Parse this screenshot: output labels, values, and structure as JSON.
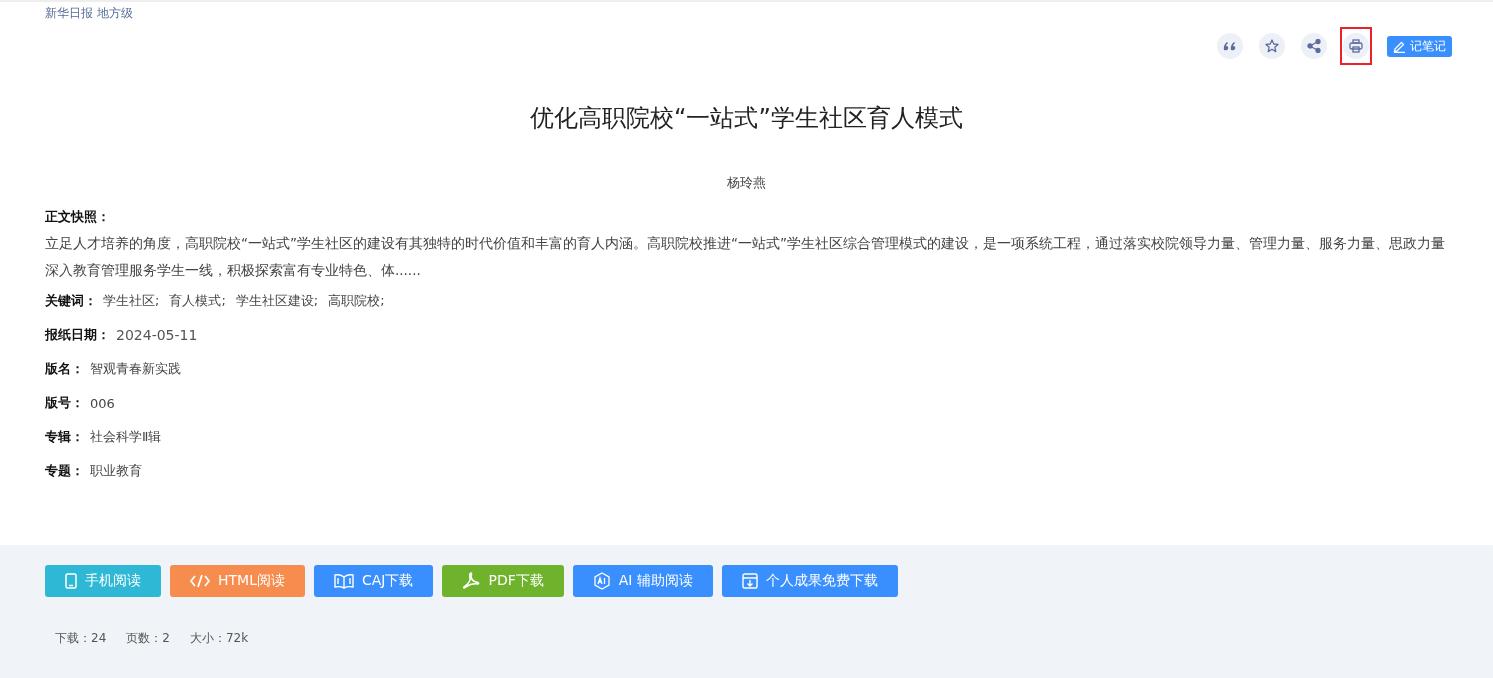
{
  "source": {
    "name": "新华日报",
    "level": "地方级"
  },
  "tools": [
    {
      "kind": "quote",
      "highlighted": false
    },
    {
      "kind": "star",
      "highlighted": false
    },
    {
      "kind": "share",
      "highlighted": false
    },
    {
      "kind": "print",
      "highlighted": true
    }
  ],
  "note_button": {
    "label": "记笔记"
  },
  "title": "优化高职院校“一站式”学生社区育人模式",
  "author": "杨玲燕",
  "snapshot": {
    "label": "正文快照：",
    "text": "立足人才培养的角度，高职院校“一站式”学生社区的建设有其独特的时代价值和丰富的育人内涵。高职院校推进“一站式”学生社区综合管理模式的建设，是一项系统工程，通过落实校院领导力量、管理力量、服务力量、思政力量深入教育管理服务学生一线，积极探索富有专业特色、体......"
  },
  "keywords": {
    "label": "关键词：",
    "items": [
      "学生社区;",
      "育人模式;",
      "学生社区建设;",
      "高职院校;"
    ]
  },
  "fields": [
    {
      "label": "报纸日期：",
      "value": "2024-05-11"
    },
    {
      "label": "版名：",
      "value": "智观青春新实践"
    },
    {
      "label": "版号：",
      "value": "006"
    },
    {
      "label": "专辑：",
      "value": "社会科学Ⅱ辑"
    },
    {
      "label": "专题：",
      "value": "职业教育"
    }
  ],
  "actions": [
    {
      "kind": "phone",
      "label": "手机阅读",
      "color": "#2fb8d6"
    },
    {
      "kind": "code",
      "label": "HTML阅读",
      "color": "#f68c4e"
    },
    {
      "kind": "book",
      "label": "CAJ下载",
      "color": "#3a8ffe"
    },
    {
      "kind": "pdf",
      "label": "PDF下载",
      "color": "#6fb32d"
    },
    {
      "kind": "ai",
      "label": "AI 辅助阅读",
      "color": "#3a8ffe"
    },
    {
      "kind": "download",
      "label": "个人成果免费下载",
      "color": "#3a8ffe"
    }
  ],
  "stats": [
    {
      "label": "下载：",
      "value": "24"
    },
    {
      "label": "页数：",
      "value": "2"
    },
    {
      "label": "大小：",
      "value": "72k"
    }
  ]
}
